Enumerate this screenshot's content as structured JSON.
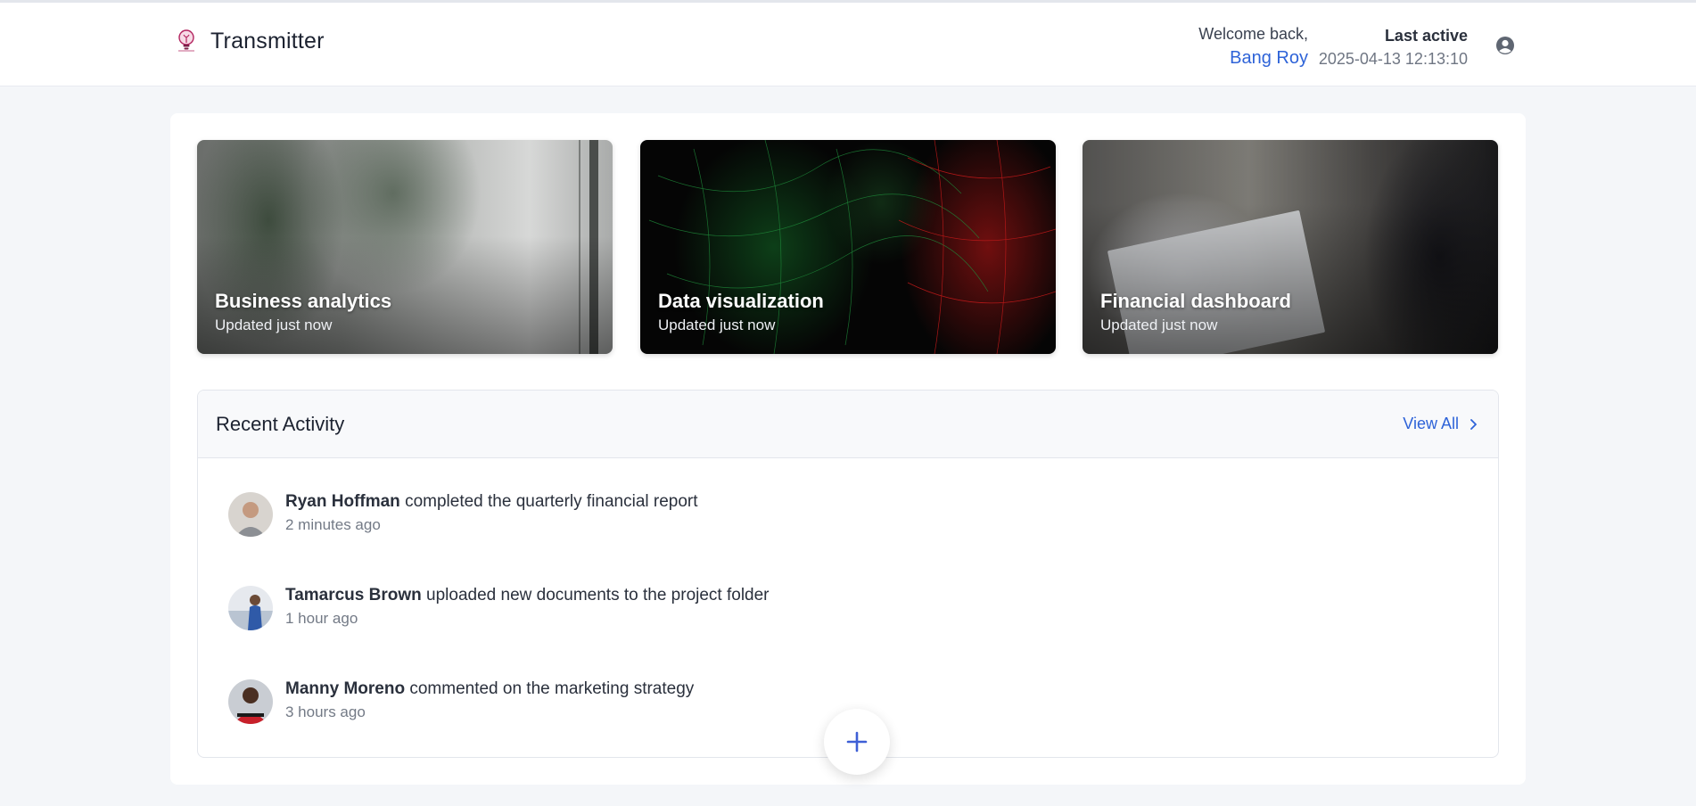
{
  "app": {
    "title": "Transmitter"
  },
  "header": {
    "welcome_label": "Welcome back,",
    "user_name": "Bang Roy",
    "last_active_label": "Last active",
    "last_active_time": "2025-04-13 12:13:10"
  },
  "cards": [
    {
      "title": "Business analytics",
      "subtitle": "Updated just now"
    },
    {
      "title": "Data visualization",
      "subtitle": "Updated just now"
    },
    {
      "title": "Financial dashboard",
      "subtitle": "Updated just now"
    }
  ],
  "activity": {
    "title": "Recent Activity",
    "view_all": "View All",
    "items": [
      {
        "name": "Ryan Hoffman",
        "action": "completed the quarterly financial report",
        "time": "2 minutes ago"
      },
      {
        "name": "Tamarcus Brown",
        "action": "uploaded new documents to the project folder",
        "time": "1 hour ago"
      },
      {
        "name": "Manny Moreno",
        "action": "commented on the marketing strategy",
        "time": "3 hours ago"
      }
    ]
  },
  "icons": {
    "logo": "lightbulb-logo-icon",
    "user": "user-circle-icon",
    "view_all": "chevron-right-icon",
    "fab": "plus-icon"
  },
  "colors": {
    "accent": "#2e63d8",
    "background": "#f4f6f9",
    "panel": "#ffffff"
  }
}
